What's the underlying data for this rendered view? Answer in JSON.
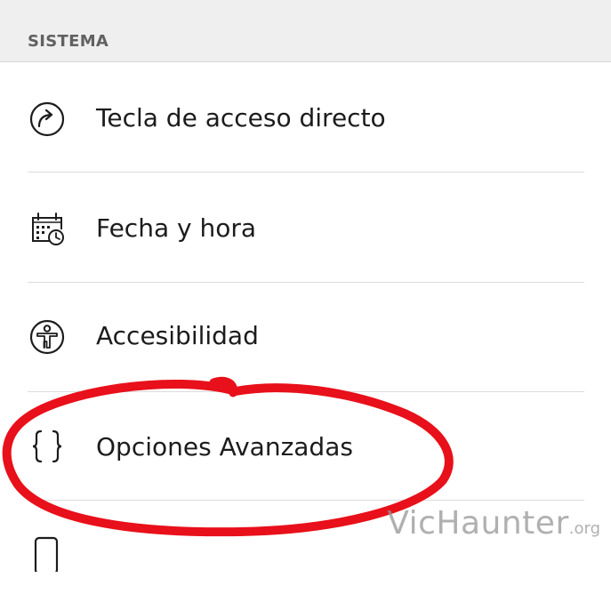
{
  "section": {
    "title": "SISTEMA"
  },
  "items": [
    {
      "label": "Tecla de acceso directo",
      "icon": "shortcut-arrow-icon"
    },
    {
      "label": "Fecha y hora",
      "icon": "calendar-clock-icon"
    },
    {
      "label": "Accesibilidad",
      "icon": "accessibility-icon"
    },
    {
      "label": "Opciones Avanzadas",
      "icon": "curly-braces-icon"
    },
    {
      "label": "",
      "icon": "partial-icon"
    }
  ],
  "annotation": {
    "color": "#e8101a",
    "target": "Opciones Avanzadas"
  },
  "watermark": {
    "main": "VicHaunter",
    "tld": ".org"
  },
  "colors": {
    "header_bg": "#efefef",
    "header_text": "#616161",
    "label_text": "#1c1c1c",
    "divider": "#dcdcdc",
    "annotation_red": "#e8101a"
  }
}
